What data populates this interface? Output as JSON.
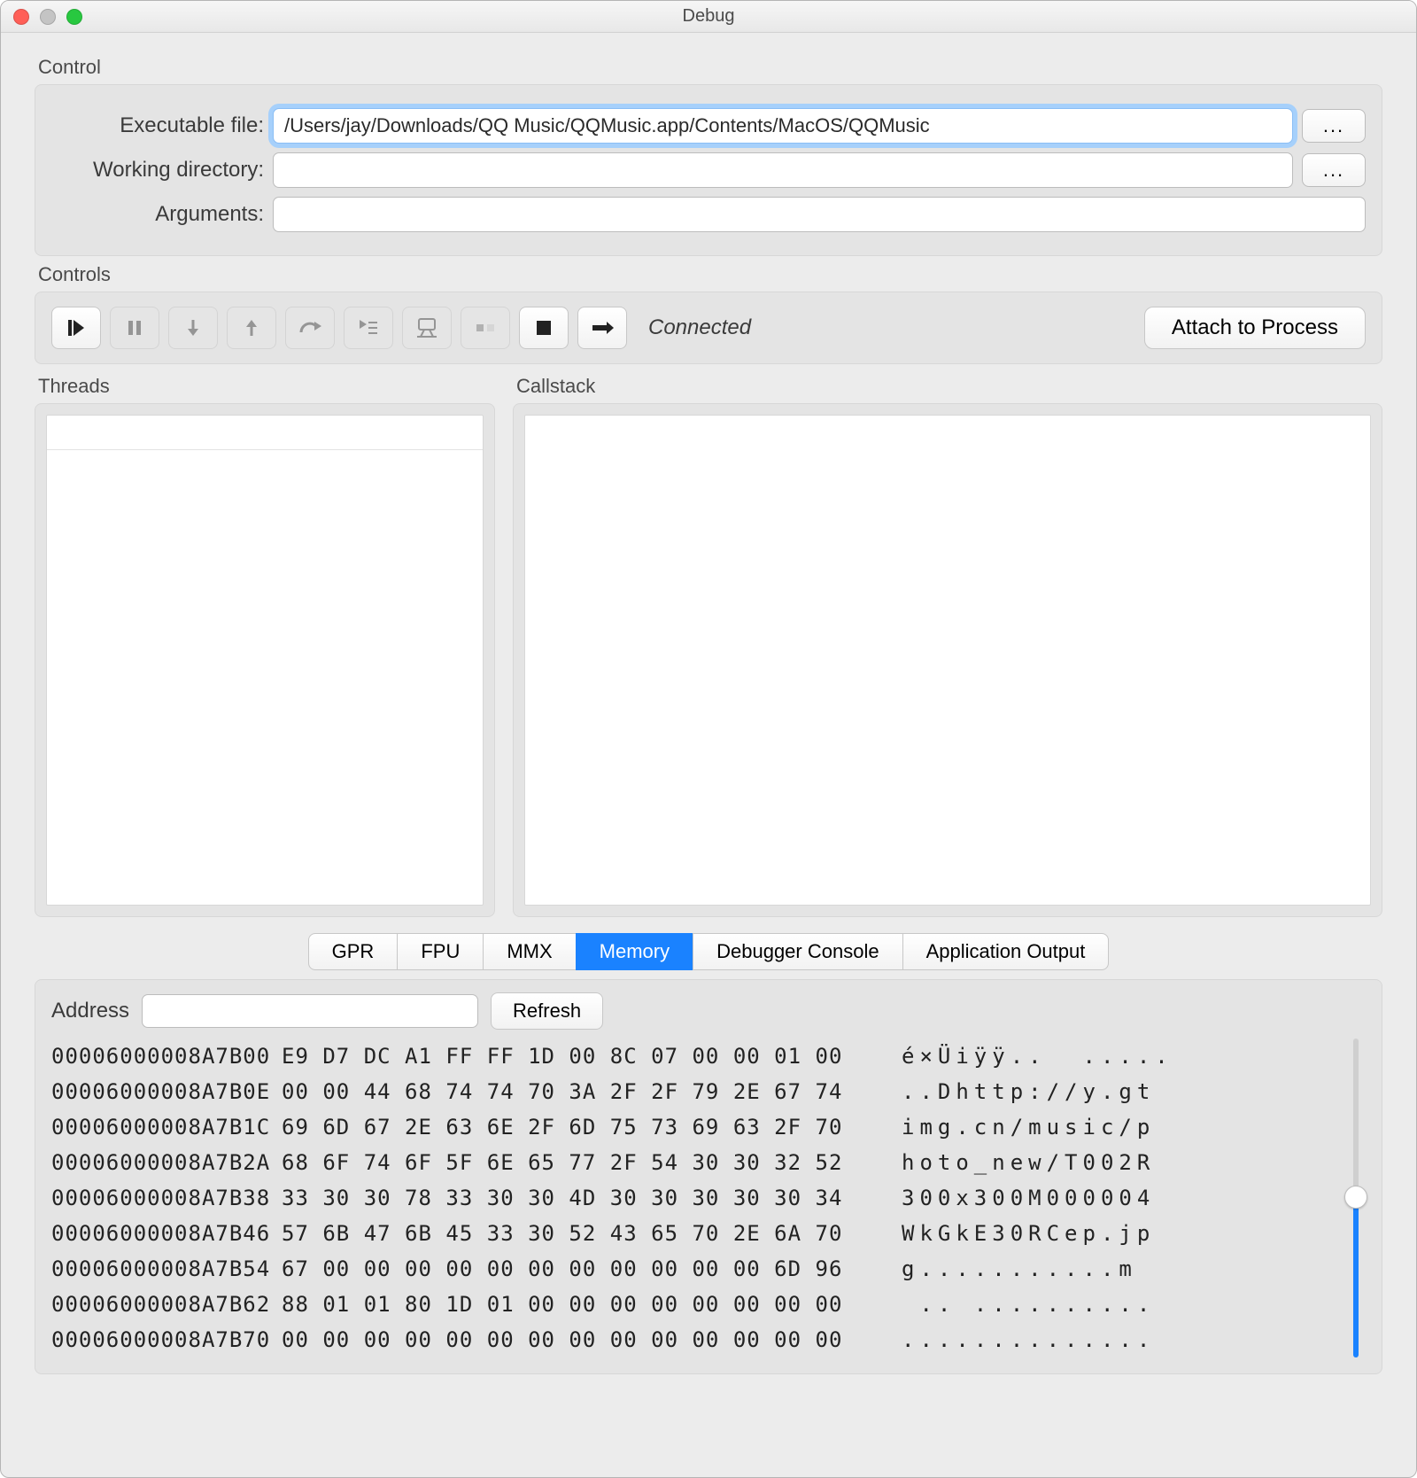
{
  "window": {
    "title": "Debug"
  },
  "control": {
    "label": "Control",
    "exec_label": "Executable file:",
    "exec_value": "/Users/jay/Downloads/QQ Music/QQMusic.app/Contents/MacOS/QQMusic",
    "wd_label": "Working directory:",
    "wd_value": "",
    "args_label": "Arguments:",
    "args_value": "",
    "browse_label": "..."
  },
  "controls": {
    "label": "Controls",
    "status": "Connected",
    "attach_label": "Attach to Process"
  },
  "threads_label": "Threads",
  "callstack_label": "Callstack",
  "tabs": {
    "gpr": "GPR",
    "fpu": "FPU",
    "mmx": "MMX",
    "memory": "Memory",
    "console": "Debugger Console",
    "appout": "Application Output"
  },
  "memory": {
    "address_label": "Address",
    "address_value": "",
    "refresh_label": "Refresh",
    "rows": [
      {
        "a": "00006000008A7B00",
        "h": "E9 D7 DC A1 FF FF 1D 00 8C 07 00 00 01 00",
        "t": "é×Üiÿÿ..  ....."
      },
      {
        "a": "00006000008A7B0E",
        "h": "00 00 44 68 74 74 70 3A 2F 2F 79 2E 67 74",
        "t": "..Dhttp://y.gt"
      },
      {
        "a": "00006000008A7B1C",
        "h": "69 6D 67 2E 63 6E 2F 6D 75 73 69 63 2F 70",
        "t": "img.cn/music/p"
      },
      {
        "a": "00006000008A7B2A",
        "h": "68 6F 74 6F 5F 6E 65 77 2F 54 30 30 32 52",
        "t": "hoto_new/T002R"
      },
      {
        "a": "00006000008A7B38",
        "h": "33 30 30 78 33 30 30 4D 30 30 30 30 30 34",
        "t": "300x300M000004"
      },
      {
        "a": "00006000008A7B46",
        "h": "57 6B 47 6B 45 33 30 52 43 65 70 2E 6A 70",
        "t": "WkGkE30RCep.jp"
      },
      {
        "a": "00006000008A7B54",
        "h": "67 00 00 00 00 00 00 00 00 00 00 00 6D 96",
        "t": "g...........m "
      },
      {
        "a": "00006000008A7B62",
        "h": "88 01 01 80 1D 01 00 00 00 00 00 00 00 00",
        "t": " .. .........."
      },
      {
        "a": "00006000008A7B70",
        "h": "00 00 00 00 00 00 00 00 00 00 00 00 00 00",
        "t": ".............."
      }
    ]
  }
}
